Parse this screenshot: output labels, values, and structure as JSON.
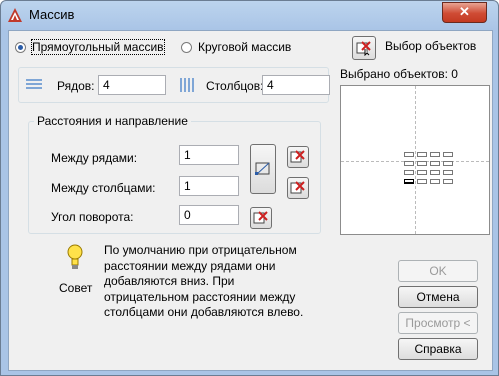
{
  "window": {
    "title": "Массив",
    "close_glyph": "✕"
  },
  "array_type": {
    "rectangular_label": "Прямоугольный массив",
    "polar_label": "Круговой массив",
    "selected": "rectangular"
  },
  "select_objects": {
    "label": "Выбор объектов",
    "count_text": "Выбрано объектов: 0"
  },
  "grid": {
    "rows_label": "Рядов:",
    "rows_value": "4",
    "cols_label": "Столбцов:",
    "cols_value": "4"
  },
  "offset": {
    "group_title": "Расстояния и направление",
    "row_offset_label": "Между рядами:",
    "row_offset_value": "1",
    "col_offset_label": "Между столбцами:",
    "col_offset_value": "1",
    "angle_label": "Угол поворота:",
    "angle_value": "0"
  },
  "tip": {
    "label": "Совет",
    "text": "По умолчанию при отрицательном расстоянии между рядами они добавляются вниз. При отрицательном расстоянии между столбцами они добавляются влево."
  },
  "buttons": {
    "ok": "OK",
    "cancel": "Отмена",
    "preview": "Просмотр <",
    "help": "Справка"
  },
  "colors": {
    "accent": "#2a5ca8",
    "close_red": "#c43a22",
    "pick_cross": "#cc2020"
  }
}
